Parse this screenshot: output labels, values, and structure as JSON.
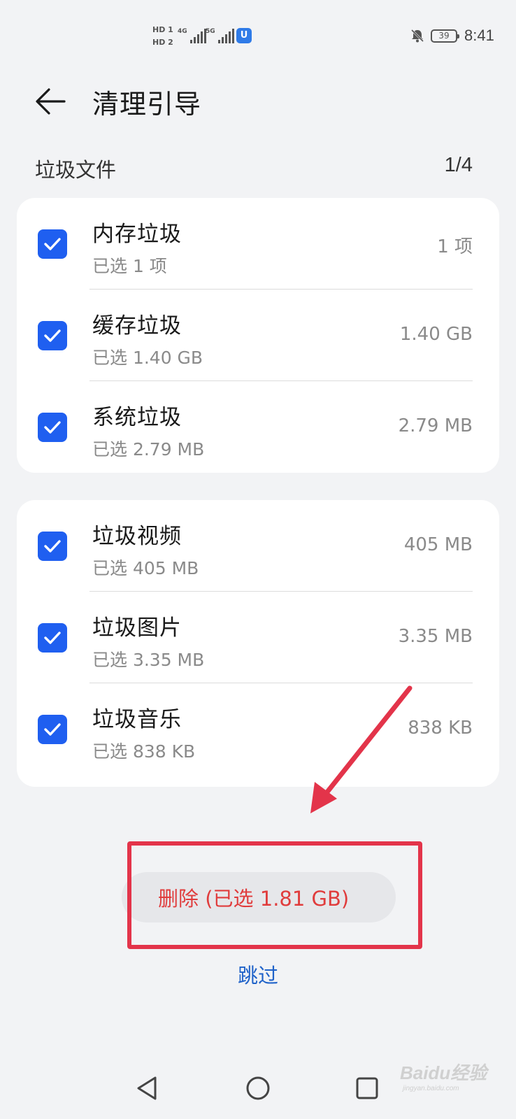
{
  "status_bar": {
    "hd1": "HD 1",
    "hd2": "HD 2",
    "net1": "4G",
    "net2": "5G",
    "battery": "39",
    "time": "8:41"
  },
  "header": {
    "title": "清理引导",
    "back_icon": "arrow-left-icon"
  },
  "section": {
    "label": "垃圾文件",
    "count": "1/4"
  },
  "groups": [
    {
      "items": [
        {
          "name": "内存垃圾",
          "sub": "已选 1 项",
          "size": "1 项",
          "checked": true
        },
        {
          "name": "缓存垃圾",
          "sub": "已选 1.40 GB",
          "size": "1.40 GB",
          "checked": true
        },
        {
          "name": "系统垃圾",
          "sub": "已选 2.79 MB",
          "size": "2.79 MB",
          "checked": true
        }
      ]
    },
    {
      "items": [
        {
          "name": "垃圾视频",
          "sub": "已选 405 MB",
          "size": "405 MB",
          "checked": true
        },
        {
          "name": "垃圾图片",
          "sub": "已选 3.35 MB",
          "size": "3.35 MB",
          "checked": true
        },
        {
          "name": "垃圾音乐",
          "sub": "已选 838 KB",
          "size": "838 KB",
          "checked": true
        }
      ]
    }
  ],
  "actions": {
    "delete_label": "删除 (已选 1.81 GB)",
    "skip_label": "跳过"
  },
  "annotation": {
    "color": "#e3344a"
  },
  "colors": {
    "accent": "#1f5ff0",
    "delete_text": "#e03c3c",
    "skip_text": "#1f62c9"
  },
  "watermark": {
    "brand": "Baidu经验",
    "url": "jingyan.baidu.com"
  }
}
